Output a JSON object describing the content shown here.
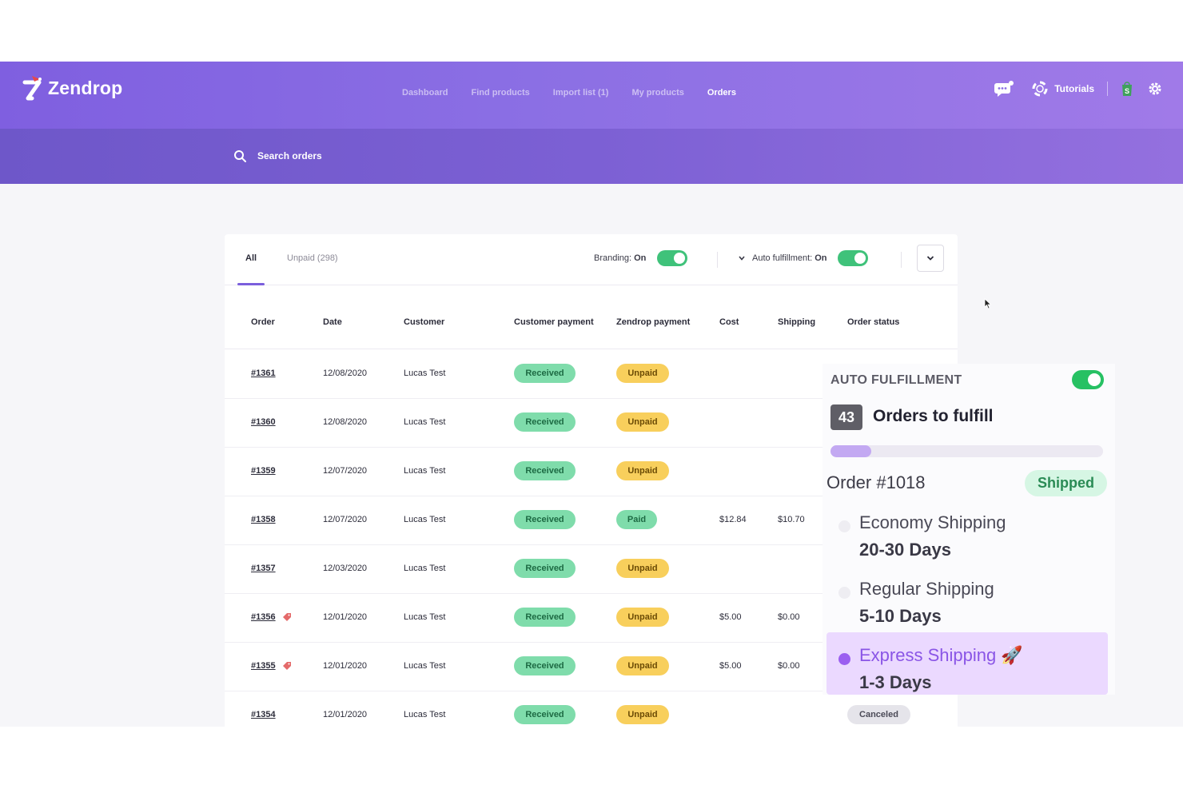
{
  "brand": {
    "name": "Zendrop"
  },
  "nav": {
    "items": [
      {
        "label": "Dashboard",
        "active": false
      },
      {
        "label": "Find products",
        "active": false
      },
      {
        "label": "Import list (1)",
        "active": false
      },
      {
        "label": "My products",
        "active": false
      },
      {
        "label": "Orders",
        "active": true
      }
    ],
    "tutorials_label": "Tutorials",
    "icons": [
      "chat-icon",
      "lifebuoy-icon",
      "shopify-icon",
      "gear-icon"
    ]
  },
  "search": {
    "label": "Search orders"
  },
  "tabs": {
    "all": "All",
    "unpaid": "Unpaid (298)"
  },
  "controls": {
    "branding_label": "Branding:",
    "branding_value": "On",
    "auto_label": "Auto fulfillment:",
    "auto_value": "On"
  },
  "table": {
    "columns": [
      "Order",
      "Date",
      "Customer",
      "Customer payment",
      "Zendrop payment",
      "Cost",
      "Shipping",
      "Order status"
    ],
    "rows": [
      {
        "order": "#1361",
        "date": "12/08/2020",
        "customer": "Lucas Test",
        "customer_payment": "Received",
        "zendrop_payment": "Unpaid",
        "cost": "",
        "shipping": "",
        "status": "",
        "tag": false
      },
      {
        "order": "#1360",
        "date": "12/08/2020",
        "customer": "Lucas Test",
        "customer_payment": "Received",
        "zendrop_payment": "Unpaid",
        "cost": "",
        "shipping": "",
        "status": "",
        "tag": false
      },
      {
        "order": "#1359",
        "date": "12/07/2020",
        "customer": "Lucas Test",
        "customer_payment": "Received",
        "zendrop_payment": "Unpaid",
        "cost": "",
        "shipping": "",
        "status": "",
        "tag": false
      },
      {
        "order": "#1358",
        "date": "12/07/2020",
        "customer": "Lucas Test",
        "customer_payment": "Received",
        "zendrop_payment": "Paid",
        "cost": "$12.84",
        "shipping": "$10.70",
        "status": "",
        "tag": false
      },
      {
        "order": "#1357",
        "date": "12/03/2020",
        "customer": "Lucas Test",
        "customer_payment": "Received",
        "zendrop_payment": "Unpaid",
        "cost": "",
        "shipping": "",
        "status": "",
        "tag": false
      },
      {
        "order": "#1356",
        "date": "12/01/2020",
        "customer": "Lucas Test",
        "customer_payment": "Received",
        "zendrop_payment": "Unpaid",
        "cost": "$5.00",
        "shipping": "$0.00",
        "status": "",
        "tag": true
      },
      {
        "order": "#1355",
        "date": "12/01/2020",
        "customer": "Lucas Test",
        "customer_payment": "Received",
        "zendrop_payment": "Unpaid",
        "cost": "$5.00",
        "shipping": "$0.00",
        "status": "",
        "tag": true
      },
      {
        "order": "#1354",
        "date": "12/01/2020",
        "customer": "Lucas Test",
        "customer_payment": "Received",
        "zendrop_payment": "Unpaid",
        "cost": "",
        "shipping": "",
        "status": "Canceled",
        "tag": false
      }
    ]
  },
  "panel": {
    "title": "AUTO FULFILLMENT",
    "count": "43",
    "heading": "Orders to fulfill",
    "progress": 0.15,
    "order_title": "Order #1018",
    "order_status": "Shipped",
    "options": [
      {
        "name": "Economy Shipping",
        "days": "20-30 Days",
        "selected": false
      },
      {
        "name": "Regular Shipping",
        "days": "5-10 Days",
        "selected": false
      },
      {
        "name": "Express Shipping 🚀",
        "days": "1-3 Days",
        "selected": true
      }
    ]
  },
  "colors": {
    "brand_purple": "#8b6fe4",
    "received": "#7fdcab",
    "unpaid": "#f8cf5c",
    "toggle_on": "#3fc27a",
    "express_bg": "#ebd9ff"
  }
}
